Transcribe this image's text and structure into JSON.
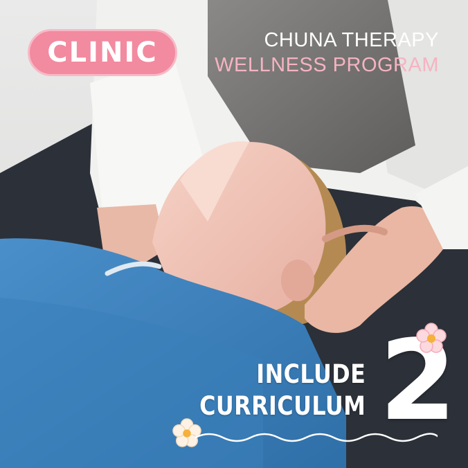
{
  "badge": {
    "label": "CLINIC"
  },
  "heading": {
    "line1": "CHUNA THERAPY",
    "line2": "WELLNESS PROGRAM"
  },
  "curriculum": {
    "line1": "INCLUDE",
    "line2": "CURRICULUM",
    "number": "2"
  },
  "colors": {
    "badge_fill": "#f28aa0",
    "badge_border": "#f7b9c6",
    "subtitle_pink": "#f6b3c2",
    "text_white": "#ffffff",
    "gown_blue": "#3c82bd",
    "flower_center": "#f5b13a"
  },
  "icons": [
    "flower-icon",
    "wave-underline"
  ]
}
